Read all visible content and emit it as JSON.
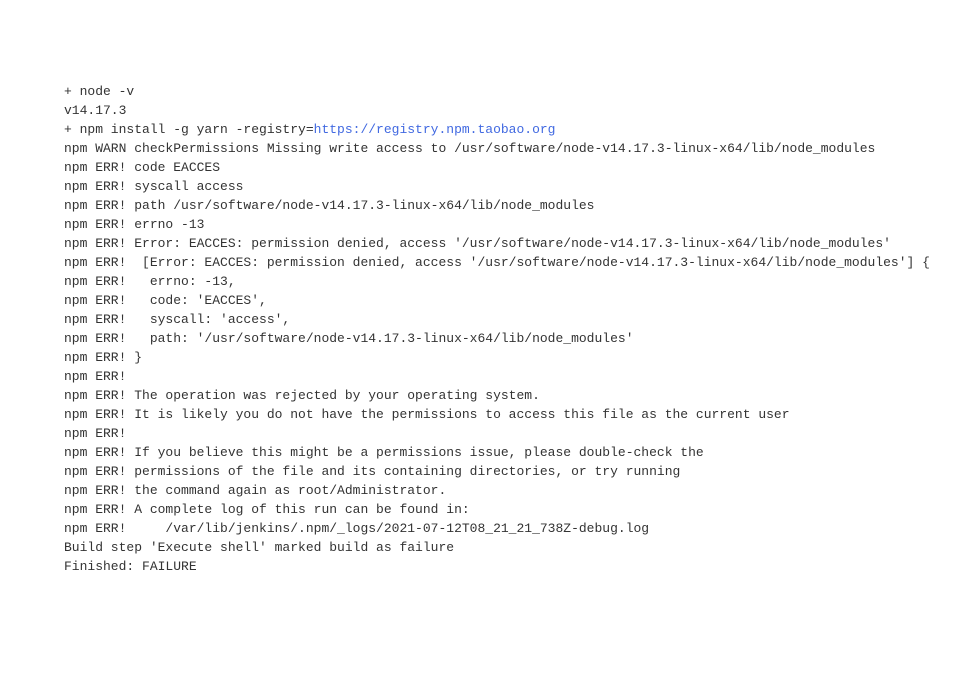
{
  "console_output": {
    "lines": [
      {
        "type": "plain",
        "text": "+ node -v"
      },
      {
        "type": "plain",
        "text": "v14.17.3"
      },
      {
        "type": "with_url",
        "prefix": "+ npm install -g yarn -registry=",
        "url": "https://registry.npm.taobao.org"
      },
      {
        "type": "plain",
        "text": "npm WARN checkPermissions Missing write access to /usr/software/node-v14.17.3-linux-x64/lib/node_modules"
      },
      {
        "type": "plain",
        "text": "npm ERR! code EACCES"
      },
      {
        "type": "plain",
        "text": "npm ERR! syscall access"
      },
      {
        "type": "plain",
        "text": "npm ERR! path /usr/software/node-v14.17.3-linux-x64/lib/node_modules"
      },
      {
        "type": "plain",
        "text": "npm ERR! errno -13"
      },
      {
        "type": "plain",
        "text": "npm ERR! Error: EACCES: permission denied, access '/usr/software/node-v14.17.3-linux-x64/lib/node_modules'"
      },
      {
        "type": "plain",
        "text": "npm ERR!  [Error: EACCES: permission denied, access '/usr/software/node-v14.17.3-linux-x64/lib/node_modules'] {"
      },
      {
        "type": "plain",
        "text": "npm ERR!   errno: -13,"
      },
      {
        "type": "plain",
        "text": "npm ERR!   code: 'EACCES',"
      },
      {
        "type": "plain",
        "text": "npm ERR!   syscall: 'access',"
      },
      {
        "type": "plain",
        "text": "npm ERR!   path: '/usr/software/node-v14.17.3-linux-x64/lib/node_modules'"
      },
      {
        "type": "plain",
        "text": "npm ERR! }"
      },
      {
        "type": "plain",
        "text": "npm ERR! "
      },
      {
        "type": "plain",
        "text": "npm ERR! The operation was rejected by your operating system."
      },
      {
        "type": "plain",
        "text": "npm ERR! It is likely you do not have the permissions to access this file as the current user"
      },
      {
        "type": "plain",
        "text": "npm ERR! "
      },
      {
        "type": "plain",
        "text": "npm ERR! If you believe this might be a permissions issue, please double-check the"
      },
      {
        "type": "plain",
        "text": "npm ERR! permissions of the file and its containing directories, or try running"
      },
      {
        "type": "plain",
        "text": "npm ERR! the command again as root/Administrator."
      },
      {
        "type": "plain",
        "text": ""
      },
      {
        "type": "plain",
        "text": "npm ERR! A complete log of this run can be found in:"
      },
      {
        "type": "plain",
        "text": "npm ERR!     /var/lib/jenkins/.npm/_logs/2021-07-12T08_21_21_738Z-debug.log"
      },
      {
        "type": "plain",
        "text": "Build step 'Execute shell' marked build as failure"
      },
      {
        "type": "plain",
        "text": "Finished: FAILURE"
      }
    ]
  }
}
